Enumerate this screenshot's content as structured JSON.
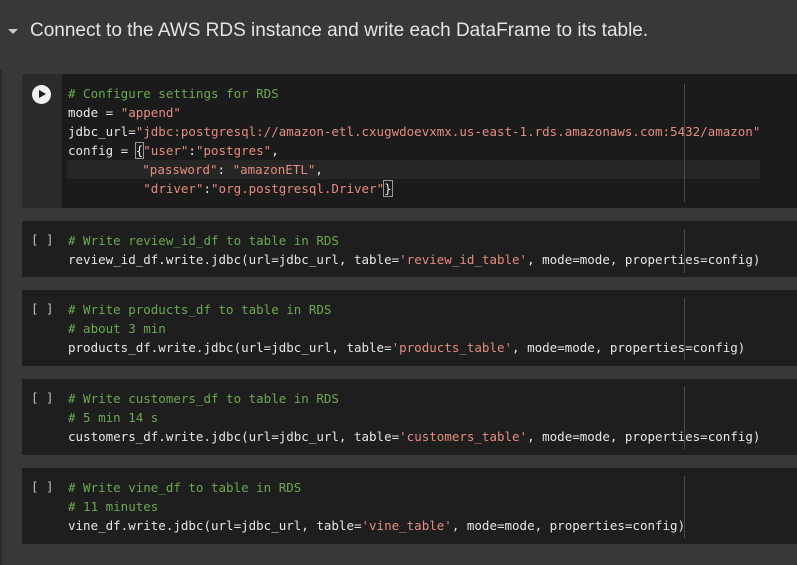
{
  "section": {
    "title": "Connect to the AWS RDS instance and write each DataFrame to its table."
  },
  "cells": [
    {
      "execution": "",
      "lines": [
        [
          {
            "t": "# Configure settings for RDS",
            "c": "cm"
          }
        ],
        [
          {
            "t": "mode = ",
            "c": "pl"
          },
          {
            "t": "\"append\"",
            "c": "st"
          }
        ],
        [
          {
            "t": "jdbc_url=",
            "c": "pl"
          },
          {
            "t": "\"jdbc:postgresql://amazon-etl.cxugwdoevxmx.us-east-1.rds.amazonaws.com:5432/amazon\"",
            "c": "st"
          }
        ],
        [
          {
            "t": "config = ",
            "c": "pl"
          },
          {
            "t": "{",
            "c": "pl",
            "box": true
          },
          {
            "t": "\"user\"",
            "c": "st"
          },
          {
            "t": ":",
            "c": "pl"
          },
          {
            "t": "\"postgres\"",
            "c": "st"
          },
          {
            "t": ",",
            "c": "pl"
          }
        ],
        [
          {
            "t": "          ",
            "c": "pl"
          },
          {
            "t": "\"password\"",
            "c": "st"
          },
          {
            "t": ": ",
            "c": "pl"
          },
          {
            "t": "\"amazonETL\"",
            "c": "st"
          },
          {
            "t": ",",
            "c": "pl"
          }
        ],
        [
          {
            "t": "          ",
            "c": "pl"
          },
          {
            "t": "\"driver\"",
            "c": "st"
          },
          {
            "t": ":",
            "c": "pl"
          },
          {
            "t": "\"org.postgresql.Driver\"",
            "c": "st"
          },
          {
            "t": "}",
            "c": "pl",
            "box": true
          }
        ]
      ]
    },
    {
      "execution": "[ ]",
      "lines": [
        [
          {
            "t": "# Write review_id_df to table in RDS",
            "c": "cm"
          }
        ],
        [
          {
            "t": "review_id_df.write.jdbc(url=jdbc_url, table=",
            "c": "pl"
          },
          {
            "t": "'review_id_table'",
            "c": "st"
          },
          {
            "t": ", mode=mode, properties=config)",
            "c": "pl"
          }
        ]
      ]
    },
    {
      "execution": "[ ]",
      "lines": [
        [
          {
            "t": "# Write products_df to table in RDS",
            "c": "cm"
          }
        ],
        [
          {
            "t": "# about 3 min",
            "c": "cm"
          }
        ],
        [
          {
            "t": "products_df.write.jdbc(url=jdbc_url, table=",
            "c": "pl"
          },
          {
            "t": "'products_table'",
            "c": "st"
          },
          {
            "t": ", mode=mode, properties=config)",
            "c": "pl"
          }
        ]
      ]
    },
    {
      "execution": "[ ]",
      "lines": [
        [
          {
            "t": "# Write customers_df to table in RDS",
            "c": "cm"
          }
        ],
        [
          {
            "t": "# 5 min 14 s",
            "c": "cm"
          }
        ],
        [
          {
            "t": "customers_df.write.jdbc(url=jdbc_url, table=",
            "c": "pl"
          },
          {
            "t": "'customers_table'",
            "c": "st"
          },
          {
            "t": ", mode=mode, properties=config)",
            "c": "pl"
          }
        ]
      ]
    },
    {
      "execution": "[ ]",
      "lines": [
        [
          {
            "t": "# Write vine_df to table in RDS",
            "c": "cm"
          }
        ],
        [
          {
            "t": "# 11 minutes",
            "c": "cm"
          }
        ],
        [
          {
            "t": "vine_df.write.jdbc(url=jdbc_url, table=",
            "c": "pl"
          },
          {
            "t": "'vine_table'",
            "c": "st"
          },
          {
            "t": ", mode=mode, properties=config)",
            "c": "pl"
          }
        ]
      ]
    }
  ],
  "colors": {
    "comment": "#6aa84f",
    "string": "#e58c7e",
    "code": "#e6e6e6",
    "background": "#383838",
    "cell_background": "#1e1e1e"
  }
}
